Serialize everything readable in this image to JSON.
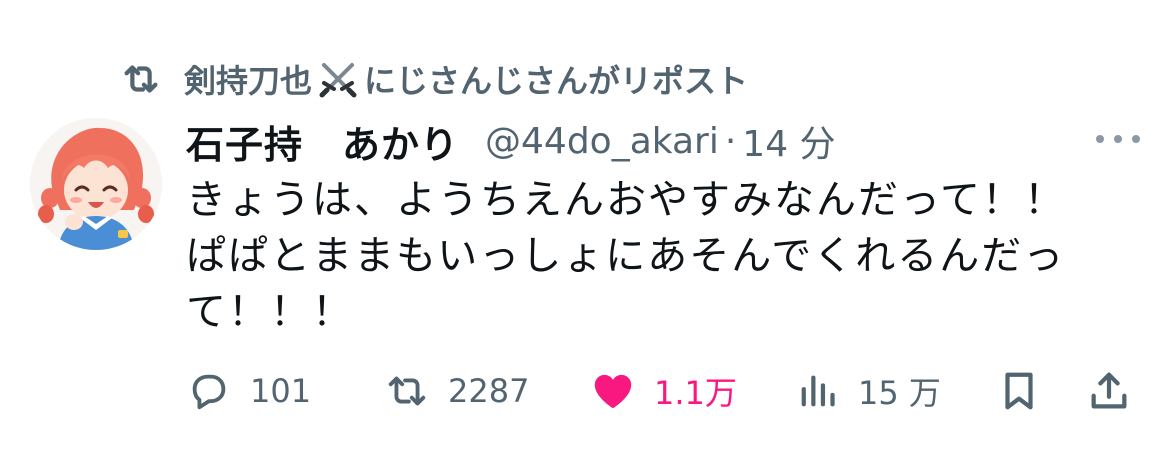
{
  "repost": {
    "icon": "repost-icon",
    "reposter_name": "剣持刀也",
    "badge_icon": "crossed-swords-icon",
    "suffix": "にじさんじさんがリポスト"
  },
  "tweet": {
    "avatar_icon": "avatar",
    "display_name": "石子持　あかり",
    "handle": "@44do_akari",
    "separator": "·",
    "time": "14 分",
    "more_icon": "more-icon",
    "text_lines": [
      "きょうは、ようちえんおやすみなんだって！！",
      "ぱぱとままもいっしょにあそんでくれるんだっ",
      "て！！！"
    ]
  },
  "actions": {
    "reply": {
      "icon": "reply-icon",
      "count": "101"
    },
    "repost": {
      "icon": "repost-icon",
      "count": "2287"
    },
    "like": {
      "icon": "heart-icon",
      "count": "1.1万",
      "color": "#f91880",
      "liked": true
    },
    "views": {
      "icon": "views-icon",
      "count": "15 万"
    },
    "bookmark": {
      "icon": "bookmark-icon"
    },
    "share": {
      "icon": "share-icon"
    }
  },
  "colors": {
    "text_primary": "#0f1419",
    "text_secondary": "#536471",
    "like": "#f91880"
  }
}
